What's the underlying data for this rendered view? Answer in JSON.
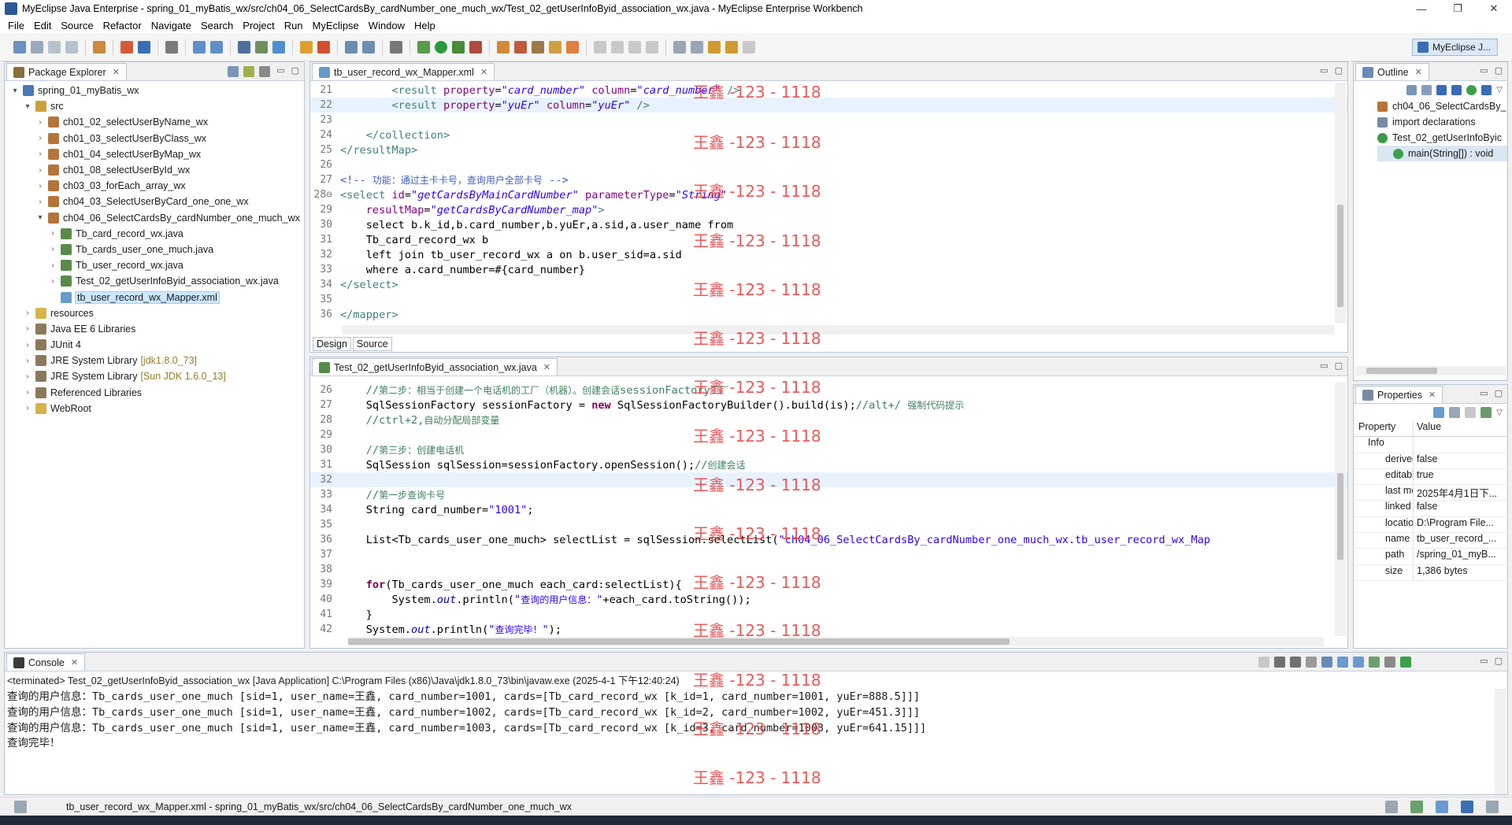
{
  "window": {
    "title": "MyEclipse Java Enterprise - spring_01_myBatis_wx/src/ch04_06_SelectCardsBy_cardNumber_one_much_wx/Test_02_getUserInfoByid_association_wx.java - MyEclipse Enterprise Workbench",
    "minimize": "—",
    "maximize": "❐",
    "close": "✕"
  },
  "menu": [
    "File",
    "Edit",
    "Source",
    "Refactor",
    "Navigate",
    "Search",
    "Project",
    "Run",
    "MyEclipse",
    "Window",
    "Help"
  ],
  "perspective": {
    "label": "MyEclipse J..."
  },
  "package_explorer": {
    "title": "Package Explorer",
    "items": [
      {
        "label": "spring_01_myBatis_wx",
        "ver": "",
        "icon": "project-icon",
        "twisty": "▾",
        "indent": 0
      },
      {
        "label": "src",
        "ver": "",
        "icon": "source-folder-icon",
        "twisty": "▾",
        "indent": 1
      },
      {
        "label": "ch01_02_selectUserByName_wx",
        "ver": "",
        "icon": "package-icon",
        "twisty": "›",
        "indent": 2
      },
      {
        "label": "ch01_03_selectUserByClass_wx",
        "ver": "",
        "icon": "package-icon",
        "twisty": "›",
        "indent": 2
      },
      {
        "label": "ch01_04_selectUserByMap_wx",
        "ver": "",
        "icon": "package-icon",
        "twisty": "›",
        "indent": 2
      },
      {
        "label": "ch01_08_selectUserById_wx",
        "ver": "",
        "icon": "package-icon",
        "twisty": "›",
        "indent": 2
      },
      {
        "label": "ch03_03_forEach_array_wx",
        "ver": "",
        "icon": "package-icon",
        "twisty": "›",
        "indent": 2
      },
      {
        "label": "ch04_03_SelectUserByCard_one_one_wx",
        "ver": "",
        "icon": "package-icon",
        "twisty": "›",
        "indent": 2
      },
      {
        "label": "ch04_06_SelectCardsBy_cardNumber_one_much_wx",
        "ver": "",
        "icon": "package-icon",
        "twisty": "▾",
        "indent": 2
      },
      {
        "label": "Tb_card_record_wx.java",
        "ver": "",
        "icon": "java-file-icon",
        "twisty": "›",
        "indent": 3
      },
      {
        "label": "Tb_cards_user_one_much.java",
        "ver": "",
        "icon": "java-file-icon",
        "twisty": "›",
        "indent": 3
      },
      {
        "label": "Tb_user_record_wx.java",
        "ver": "",
        "icon": "java-file-icon",
        "twisty": "›",
        "indent": 3
      },
      {
        "label": "Test_02_getUserInfoByid_association_wx.java",
        "ver": "",
        "icon": "java-file-icon",
        "twisty": "›",
        "indent": 3
      },
      {
        "label": "tb_user_record_wx_Mapper.xml",
        "ver": "",
        "icon": "xml-file-icon",
        "twisty": "",
        "indent": 3,
        "selected": true
      },
      {
        "label": "resources",
        "ver": "",
        "icon": "folder-icon",
        "twisty": "›",
        "indent": 1
      },
      {
        "label": "Java EE 6 Libraries",
        "ver": "",
        "icon": "library-icon",
        "twisty": "›",
        "indent": 1
      },
      {
        "label": "JUnit 4",
        "ver": "",
        "icon": "library-icon",
        "twisty": "›",
        "indent": 1
      },
      {
        "label": "JRE System Library",
        "ver": "[jdk1.8.0_73]",
        "icon": "library-icon",
        "twisty": "›",
        "indent": 1
      },
      {
        "label": "JRE System Library",
        "ver": "[Sun JDK 1.6.0_13]",
        "icon": "library-icon",
        "twisty": "›",
        "indent": 1
      },
      {
        "label": "Referenced Libraries",
        "ver": "",
        "icon": "library-icon",
        "twisty": "›",
        "indent": 1
      },
      {
        "label": "WebRoot",
        "ver": "",
        "icon": "folder-icon",
        "twisty": "›",
        "indent": 1
      }
    ]
  },
  "xml_editor": {
    "tab": "tb_user_record_wx_Mapper.xml",
    "subtabs": [
      "Design",
      "Source"
    ],
    "lines": [
      {
        "n": "21",
        "html": "        <span class='tag'>&lt;result</span> <span class='attr'>property</span>=<span class='str'>\"card_number\"</span> <span class='attr'>column</span>=<span class='str'>\"card_number\"</span> <span class='tag'>/&gt;</span>"
      },
      {
        "n": "22",
        "html": "        <span class='tag'>&lt;result</span> <span class='attr'>property</span>=<span class='str'>\"yuEr\"</span> <span class='attr'>column</span>=<span class='str'>\"yuEr\"</span> <span class='tag'>/&gt;</span>",
        "hl": true
      },
      {
        "n": "23",
        "html": ""
      },
      {
        "n": "24",
        "html": "    <span class='tag'>&lt;/collection&gt;</span>"
      },
      {
        "n": "25",
        "html": "<span class='tag'>&lt;/resultMap&gt;</span>"
      },
      {
        "n": "26",
        "html": ""
      },
      {
        "n": "27",
        "html": "<span class='cmt'>&lt;!-- <span class='cn'>功能：通过主卡卡号，查询用户全部卡号</span> --&gt;</span>"
      },
      {
        "n": "28",
        "html": "<span class='tag'>&lt;select</span> <span class='attr'>id</span>=<span class='str'>\"getCardsByMainCardNumber\"</span> <span class='attr'>parameterType</span>=<span class='str'>\"String\"</span>"
      },
      {
        "n": "29",
        "html": "    <span class='attr'>resultMap</span>=<span class='str'>\"getCardsByCardNumber_map\"</span><span class='tag'>&gt;</span>"
      },
      {
        "n": "30",
        "html": "    select b.k_id,b.card_number,b.yuEr,a.sid,a.user_name from"
      },
      {
        "n": "31",
        "html": "    Tb_card_record_wx b"
      },
      {
        "n": "32",
        "html": "    left join tb_user_record_wx a on b.user_sid=a.sid"
      },
      {
        "n": "33",
        "html": "    where a.card_number=#{card_number}"
      },
      {
        "n": "34",
        "html": "<span class='tag'>&lt;/select&gt;</span>"
      },
      {
        "n": "35",
        "html": ""
      },
      {
        "n": "36",
        "html": "<span class='tag'>&lt;/mapper&gt;</span>"
      }
    ]
  },
  "java_editor": {
    "tab": "Test_02_getUserInfoByid_association_wx.java",
    "lines": [
      {
        "n": "26",
        "html": "    <span class='jcmt'>//<span class='cn'>第二步：相当于创建一个电话机的工厂（机器）。创建会话</span>sessionFactory<span class='cn'>工厂</span></span>"
      },
      {
        "n": "27",
        "html": "    SqlSessionFactory sessionFactory = <span class='kw'>new</span> SqlSessionFactoryBuilder().build(is);<span class='jcmt'>//alt+/ <span class='cn'>强制代码提示</span></span>"
      },
      {
        "n": "28",
        "html": "    <span class='jcmt'>//ctrl+2,<span class='cn'>自动分配局部变量</span></span>"
      },
      {
        "n": "29",
        "html": ""
      },
      {
        "n": "30",
        "html": "    <span class='jcmt'>//<span class='cn'>第三步：创建电话机</span></span>"
      },
      {
        "n": "31",
        "html": "    SqlSession sqlSession=sessionFactory.openSession();<span class='jcmt'>//<span class='cn'>创建会话</span></span>"
      },
      {
        "n": "32",
        "html": "",
        "hl": true
      },
      {
        "n": "33",
        "html": "    <span class='jcmt'>//<span class='cn'>第一步查询卡号</span></span>"
      },
      {
        "n": "34",
        "html": "    String card_number=<span class='strn'>\"1001\"</span>;"
      },
      {
        "n": "35",
        "html": ""
      },
      {
        "n": "36",
        "html": "    List&lt;Tb_cards_user_one_much&gt; selectList = sqlSession.selectList(<span class='strn'>\"ch04_06_SelectCardsBy_cardNumber_one_much_wx.tb_user_record_wx_Map</span>"
      },
      {
        "n": "37",
        "html": ""
      },
      {
        "n": "38",
        "html": ""
      },
      {
        "n": "39",
        "html": "    <span class='kw'>for</span>(Tb_cards_user_one_much each_card:selectList){"
      },
      {
        "n": "40",
        "html": "        System.<span class='fld'>out</span>.println(<span class='strn'>\"<span class='cn'>查询的用户信息：</span>\"</span>+each_card.toString());"
      },
      {
        "n": "41",
        "html": "    }"
      },
      {
        "n": "42",
        "html": "    System.<span class='fld'>out</span>.println(<span class='strn'>\"<span class='cn'>查询完毕！</span>\"</span>);"
      }
    ]
  },
  "outline": {
    "title": "Outline",
    "items": [
      {
        "label": "ch04_06_SelectCardsBy_",
        "icon": "package-icon",
        "indent": 0
      },
      {
        "label": "import declarations",
        "icon": "imports-icon",
        "indent": 0
      },
      {
        "label": "Test_02_getUserInfoByic",
        "icon": "class-icon",
        "indent": 0
      },
      {
        "label": "main(String[]) : void",
        "icon": "method-icon",
        "indent": 1,
        "selected": true
      }
    ]
  },
  "properties": {
    "title": "Properties",
    "header_property": "Property",
    "header_value": "Value",
    "group": "Info",
    "rows": [
      {
        "k": "derived",
        "v": "false"
      },
      {
        "k": "editable",
        "v": "true"
      },
      {
        "k": "last modified",
        "v": "2025年4月1日下..."
      },
      {
        "k": "linked",
        "v": "false"
      },
      {
        "k": "location",
        "v": "D:\\Program File..."
      },
      {
        "k": "name",
        "v": "tb_user_record_..."
      },
      {
        "k": "path",
        "v": "/spring_01_myB..."
      },
      {
        "k": "size",
        "v": "1,386  bytes"
      }
    ]
  },
  "console": {
    "title": "Console",
    "terminated": "<terminated> Test_02_getUserInfoByid_association_wx [Java Application] C:\\Program Files (x86)\\Java\\jdk1.8.0_73\\bin\\javaw.exe (2025-4-1 下午12:40:24)",
    "lines": [
      "查询的用户信息：Tb_cards_user_one_much [sid=1, user_name=王鑫, card_number=1001, cards=[Tb_card_record_wx [k_id=1, card_number=1001, yuEr=888.5]]]",
      "查询的用户信息：Tb_cards_user_one_much [sid=1, user_name=王鑫, card_number=1002, cards=[Tb_card_record_wx [k_id=2, card_number=1002, yuEr=451.3]]]",
      "查询的用户信息：Tb_cards_user_one_much [sid=1, user_name=王鑫, card_number=1003, cards=[Tb_card_record_wx [k_id=3, card_number=1003, yuEr=641.15]]]",
      "查询完毕！"
    ]
  },
  "statusbar": {
    "text": "tb_user_record_wx_Mapper.xml - spring_01_myBatis_wx/src/ch04_06_SelectCardsBy_cardNumber_one_much_wx"
  },
  "watermark": "王鑫 -123 - 1118",
  "colors": {
    "accent": "#3a6fb5",
    "selection": "#cde8ff",
    "watermark": "#ec3c3c"
  }
}
